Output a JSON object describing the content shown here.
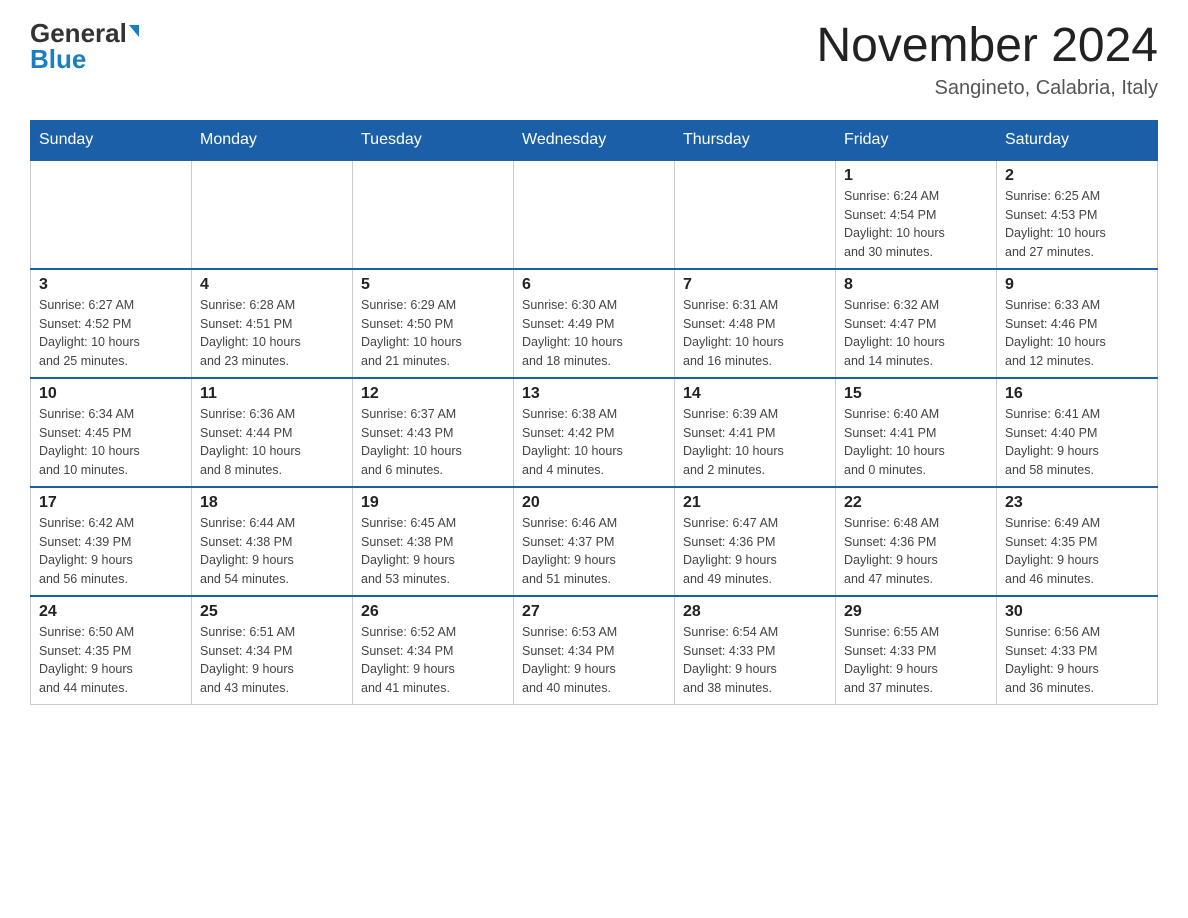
{
  "header": {
    "logo_general": "General",
    "logo_blue": "Blue",
    "title": "November 2024",
    "subtitle": "Sangineto, Calabria, Italy"
  },
  "weekdays": [
    "Sunday",
    "Monday",
    "Tuesday",
    "Wednesday",
    "Thursday",
    "Friday",
    "Saturday"
  ],
  "weeks": [
    [
      {
        "day": "",
        "info": ""
      },
      {
        "day": "",
        "info": ""
      },
      {
        "day": "",
        "info": ""
      },
      {
        "day": "",
        "info": ""
      },
      {
        "day": "",
        "info": ""
      },
      {
        "day": "1",
        "info": "Sunrise: 6:24 AM\nSunset: 4:54 PM\nDaylight: 10 hours\nand 30 minutes."
      },
      {
        "day": "2",
        "info": "Sunrise: 6:25 AM\nSunset: 4:53 PM\nDaylight: 10 hours\nand 27 minutes."
      }
    ],
    [
      {
        "day": "3",
        "info": "Sunrise: 6:27 AM\nSunset: 4:52 PM\nDaylight: 10 hours\nand 25 minutes."
      },
      {
        "day": "4",
        "info": "Sunrise: 6:28 AM\nSunset: 4:51 PM\nDaylight: 10 hours\nand 23 minutes."
      },
      {
        "day": "5",
        "info": "Sunrise: 6:29 AM\nSunset: 4:50 PM\nDaylight: 10 hours\nand 21 minutes."
      },
      {
        "day": "6",
        "info": "Sunrise: 6:30 AM\nSunset: 4:49 PM\nDaylight: 10 hours\nand 18 minutes."
      },
      {
        "day": "7",
        "info": "Sunrise: 6:31 AM\nSunset: 4:48 PM\nDaylight: 10 hours\nand 16 minutes."
      },
      {
        "day": "8",
        "info": "Sunrise: 6:32 AM\nSunset: 4:47 PM\nDaylight: 10 hours\nand 14 minutes."
      },
      {
        "day": "9",
        "info": "Sunrise: 6:33 AM\nSunset: 4:46 PM\nDaylight: 10 hours\nand 12 minutes."
      }
    ],
    [
      {
        "day": "10",
        "info": "Sunrise: 6:34 AM\nSunset: 4:45 PM\nDaylight: 10 hours\nand 10 minutes."
      },
      {
        "day": "11",
        "info": "Sunrise: 6:36 AM\nSunset: 4:44 PM\nDaylight: 10 hours\nand 8 minutes."
      },
      {
        "day": "12",
        "info": "Sunrise: 6:37 AM\nSunset: 4:43 PM\nDaylight: 10 hours\nand 6 minutes."
      },
      {
        "day": "13",
        "info": "Sunrise: 6:38 AM\nSunset: 4:42 PM\nDaylight: 10 hours\nand 4 minutes."
      },
      {
        "day": "14",
        "info": "Sunrise: 6:39 AM\nSunset: 4:41 PM\nDaylight: 10 hours\nand 2 minutes."
      },
      {
        "day": "15",
        "info": "Sunrise: 6:40 AM\nSunset: 4:41 PM\nDaylight: 10 hours\nand 0 minutes."
      },
      {
        "day": "16",
        "info": "Sunrise: 6:41 AM\nSunset: 4:40 PM\nDaylight: 9 hours\nand 58 minutes."
      }
    ],
    [
      {
        "day": "17",
        "info": "Sunrise: 6:42 AM\nSunset: 4:39 PM\nDaylight: 9 hours\nand 56 minutes."
      },
      {
        "day": "18",
        "info": "Sunrise: 6:44 AM\nSunset: 4:38 PM\nDaylight: 9 hours\nand 54 minutes."
      },
      {
        "day": "19",
        "info": "Sunrise: 6:45 AM\nSunset: 4:38 PM\nDaylight: 9 hours\nand 53 minutes."
      },
      {
        "day": "20",
        "info": "Sunrise: 6:46 AM\nSunset: 4:37 PM\nDaylight: 9 hours\nand 51 minutes."
      },
      {
        "day": "21",
        "info": "Sunrise: 6:47 AM\nSunset: 4:36 PM\nDaylight: 9 hours\nand 49 minutes."
      },
      {
        "day": "22",
        "info": "Sunrise: 6:48 AM\nSunset: 4:36 PM\nDaylight: 9 hours\nand 47 minutes."
      },
      {
        "day": "23",
        "info": "Sunrise: 6:49 AM\nSunset: 4:35 PM\nDaylight: 9 hours\nand 46 minutes."
      }
    ],
    [
      {
        "day": "24",
        "info": "Sunrise: 6:50 AM\nSunset: 4:35 PM\nDaylight: 9 hours\nand 44 minutes."
      },
      {
        "day": "25",
        "info": "Sunrise: 6:51 AM\nSunset: 4:34 PM\nDaylight: 9 hours\nand 43 minutes."
      },
      {
        "day": "26",
        "info": "Sunrise: 6:52 AM\nSunset: 4:34 PM\nDaylight: 9 hours\nand 41 minutes."
      },
      {
        "day": "27",
        "info": "Sunrise: 6:53 AM\nSunset: 4:34 PM\nDaylight: 9 hours\nand 40 minutes."
      },
      {
        "day": "28",
        "info": "Sunrise: 6:54 AM\nSunset: 4:33 PM\nDaylight: 9 hours\nand 38 minutes."
      },
      {
        "day": "29",
        "info": "Sunrise: 6:55 AM\nSunset: 4:33 PM\nDaylight: 9 hours\nand 37 minutes."
      },
      {
        "day": "30",
        "info": "Sunrise: 6:56 AM\nSunset: 4:33 PM\nDaylight: 9 hours\nand 36 minutes."
      }
    ]
  ]
}
